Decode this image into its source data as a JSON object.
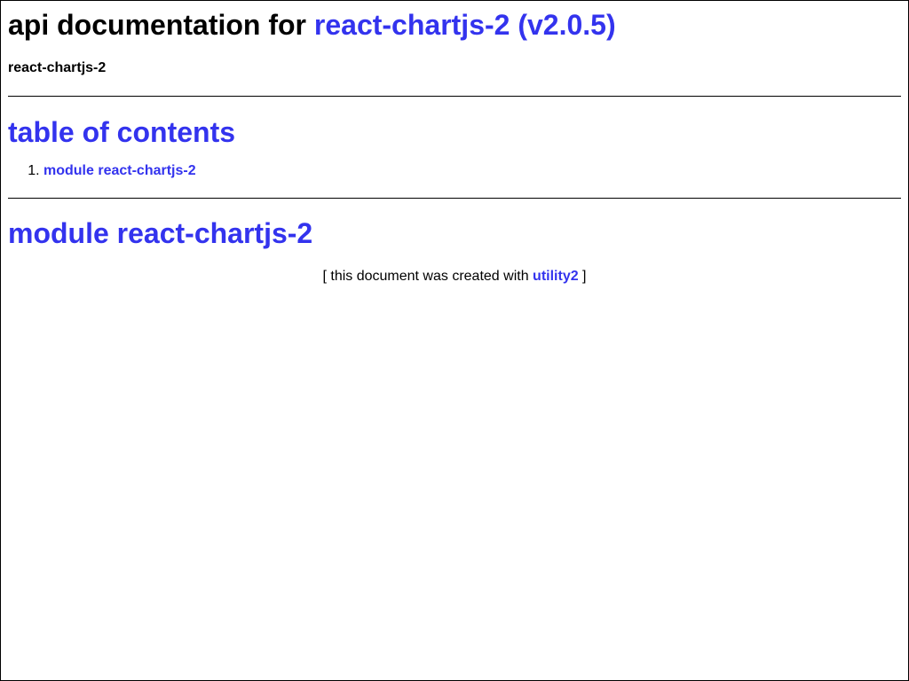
{
  "header": {
    "prefix": "api documentation for ",
    "package_link": "react-chartjs-2 (v2.0.5)",
    "subtitle": "react-chartjs-2"
  },
  "toc": {
    "heading": "table of contents",
    "items": [
      {
        "label": "module react-chartjs-2"
      }
    ]
  },
  "module": {
    "heading": "module react-chartjs-2"
  },
  "footer": {
    "prefix": "[ this document was created with ",
    "link": "utility2",
    "suffix": " ]"
  },
  "colors": {
    "link": "#3333ee",
    "text": "#000000",
    "background": "#ffffff"
  }
}
